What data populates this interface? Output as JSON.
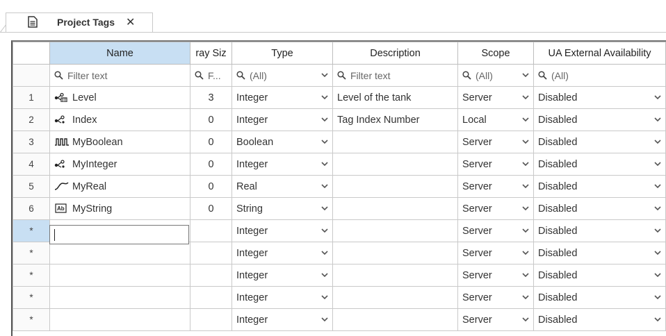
{
  "tab": {
    "label": "Project Tags",
    "close": "✕"
  },
  "columns": [
    {
      "label": "Name"
    },
    {
      "label": "ray Siz"
    },
    {
      "label": "Type"
    },
    {
      "label": "Description"
    },
    {
      "label": "Scope"
    },
    {
      "label": "UA External Availability"
    }
  ],
  "filters": {
    "name": "Filter text",
    "array": "F...",
    "type": "(All)",
    "description": "Filter text",
    "scope": "(All)",
    "ua": "(All)"
  },
  "rows": [
    {
      "num": "1",
      "icon": "array-tag-icon",
      "name": "Level",
      "size": "3",
      "type": "Integer",
      "description": "Level of the tank",
      "scope": "Server",
      "ua": "Disabled"
    },
    {
      "num": "2",
      "icon": "integer-tag-icon",
      "name": "Index",
      "size": "0",
      "type": "Integer",
      "description": "Tag Index Number",
      "scope": "Local",
      "ua": "Disabled"
    },
    {
      "num": "3",
      "icon": "boolean-tag-icon",
      "name": "MyBoolean",
      "size": "0",
      "type": "Boolean",
      "description": "",
      "scope": "Server",
      "ua": "Disabled"
    },
    {
      "num": "4",
      "icon": "integer-tag-icon",
      "name": "MyInteger",
      "size": "0",
      "type": "Integer",
      "description": "",
      "scope": "Server",
      "ua": "Disabled"
    },
    {
      "num": "5",
      "icon": "real-tag-icon",
      "name": "MyReal",
      "size": "0",
      "type": "Real",
      "description": "",
      "scope": "Server",
      "ua": "Disabled"
    },
    {
      "num": "6",
      "icon": "string-tag-icon",
      "name": "MyString",
      "size": "0",
      "type": "String",
      "description": "",
      "scope": "Server",
      "ua": "Disabled"
    }
  ],
  "new_rows": [
    {
      "num": "*",
      "type": "Integer",
      "scope": "Server",
      "ua": "Disabled"
    },
    {
      "num": "*",
      "type": "Integer",
      "scope": "Server",
      "ua": "Disabled"
    },
    {
      "num": "*",
      "type": "Integer",
      "scope": "Server",
      "ua": "Disabled"
    },
    {
      "num": "*",
      "type": "Integer",
      "scope": "Server",
      "ua": "Disabled"
    },
    {
      "num": "*",
      "type": "Integer",
      "scope": "Server",
      "ua": "Disabled"
    }
  ],
  "colors": {
    "selection": "#c8dff3",
    "grid_line": "#c9c9c9",
    "frame": "#555555"
  }
}
